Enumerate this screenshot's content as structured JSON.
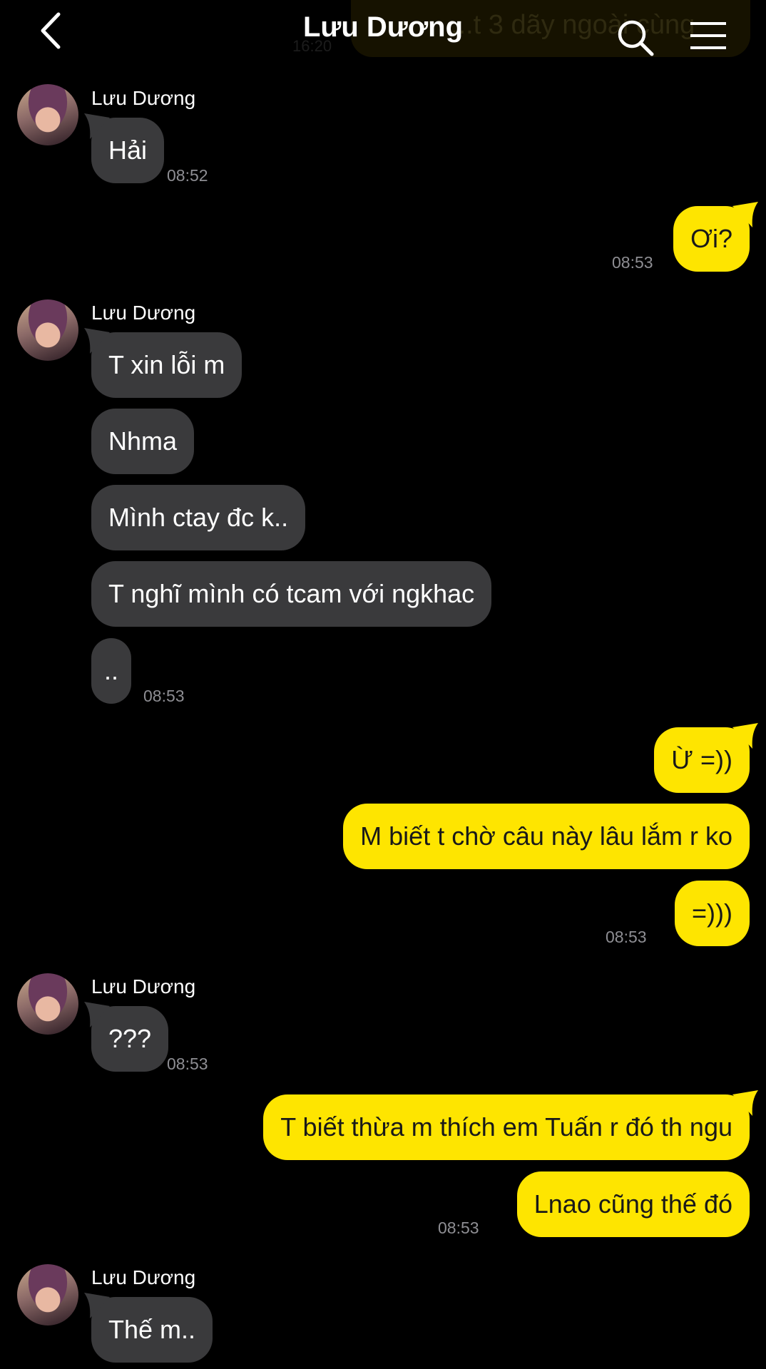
{
  "header": {
    "title": "Lưu Dương",
    "ghost_text": "...t 3 dãy ngoài cùng",
    "ghost_time": "16:20"
  },
  "colors": {
    "incoming": "#3a3a3c",
    "outgoing": "#fee500",
    "background": "#000000"
  },
  "icons": {
    "back": "chevron-left-icon",
    "search": "search-icon",
    "menu": "hamburger-menu-icon"
  },
  "messages": [
    {
      "sender": "Lưu Dương",
      "text": "Hải",
      "time": "08:52"
    },
    {
      "text": "Ơi?",
      "time": "08:53"
    },
    {
      "sender": "Lưu Dương",
      "text": "T xin lỗi m"
    },
    {
      "text": "Nhma"
    },
    {
      "text": "Mình ctay đc k.."
    },
    {
      "text": "T nghĩ mình có tcam với ngkhac"
    },
    {
      "text": "..",
      "time": "08:53"
    },
    {
      "text": "Ừ =))"
    },
    {
      "text": "M biết t chờ câu này lâu lắm r ko"
    },
    {
      "text": "=)))",
      "time": "08:53"
    },
    {
      "sender": "Lưu Dương",
      "text": "???",
      "time": "08:53"
    },
    {
      "text": "T biết thừa m thích em Tuấn r đó th ngu"
    },
    {
      "text": "Lnao cũng thế đó",
      "time": "08:53"
    },
    {
      "sender": "Lưu Dương",
      "text": "Thế m.."
    }
  ]
}
